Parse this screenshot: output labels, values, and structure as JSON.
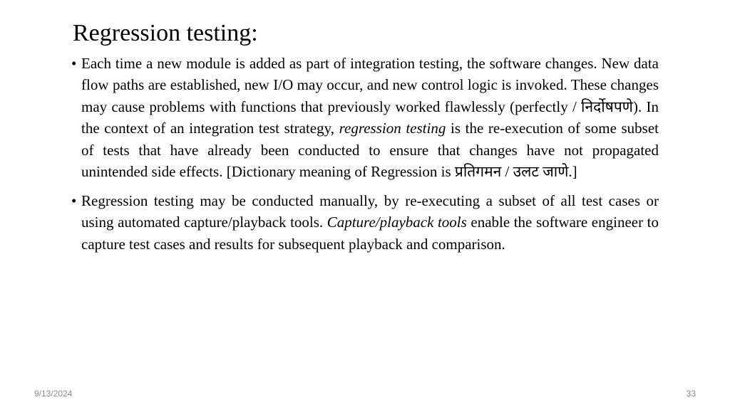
{
  "title": "Regression testing:",
  "bullets": [
    {
      "parts": [
        {
          "text": "Each time a new module is added as part of integration testing, the software changes. New data flow paths are established, new I/O may occur, and new control logic is invoked. These changes may cause problems with functions that previously worked flawlessly (perfectly / निर्दोषपणे). In the context of an integration test strategy, ",
          "style": "normal"
        },
        {
          "text": "regression testing",
          "style": "italic"
        },
        {
          "text": " is the re-execution of some subset of tests that have already been conducted to ensure that changes have not propagated unintended side effects. [Dictionary meaning of Regression is प्रतिगमन / उलट जाणे.]",
          "style": "normal"
        }
      ]
    },
    {
      "parts": [
        {
          "text": "Regression testing may be conducted manually, by re-executing a subset of all test cases or using automated capture/playback tools. ",
          "style": "normal"
        },
        {
          "text": "Capture/playback tools",
          "style": "italic"
        },
        {
          "text": " enable the software engineer to capture test cases and results for subsequent playback and comparison.",
          "style": "normal"
        }
      ]
    }
  ],
  "footer": {
    "date": "9/13/2024",
    "page": "33"
  }
}
